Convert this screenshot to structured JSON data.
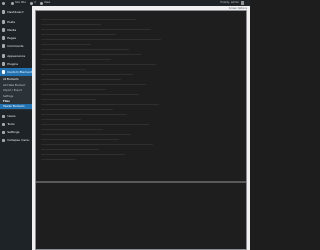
{
  "adminbar": {
    "site_name": "Site title",
    "updates_count": "0",
    "new_label": "New",
    "howdy_label": "Howdy, admin"
  },
  "sidebar": {
    "items": [
      {
        "label": "Dashboard",
        "icon": "dashboard-icon"
      },
      {
        "label": "Posts",
        "icon": "pin-icon"
      },
      {
        "label": "Media",
        "icon": "media-icon"
      },
      {
        "label": "Pages",
        "icon": "page-icon"
      },
      {
        "label": "Comments",
        "icon": "comment-icon"
      },
      {
        "label": "Appearance",
        "icon": "brush-icon"
      },
      {
        "label": "Plugins",
        "icon": "plugin-icon"
      },
      {
        "label": "Custom Elements",
        "icon": "code-icon",
        "active": true
      }
    ],
    "submenu": {
      "items": [
        "All Elements",
        "Add New Element",
        "Import / Export",
        "Settings"
      ],
      "heading": "Files",
      "highlight": "Header Elements"
    },
    "lower_items": [
      {
        "label": "Users",
        "icon": "users-icon"
      },
      {
        "label": "Tools",
        "icon": "wrench-icon"
      },
      {
        "label": "Settings",
        "icon": "settings-icon"
      },
      {
        "label": "Collapse menu",
        "icon": "collapse-icon"
      }
    ]
  },
  "main": {
    "screen_options": "Screen Options"
  },
  "colors": {
    "sidebar": "#1d2327",
    "accent": "#2271b1",
    "editor_bg": "#1e1e1e"
  }
}
